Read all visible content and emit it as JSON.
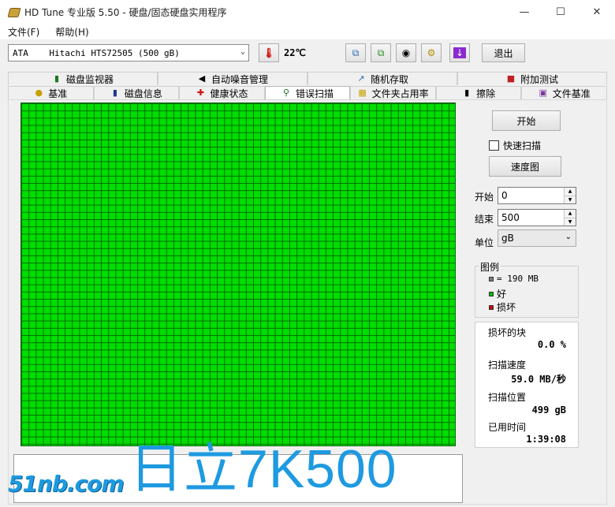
{
  "window": {
    "title": "HD Tune 专业版 5.50 - 硬盘/固态硬盘实用程序",
    "controls": {
      "minimize": "—",
      "maximize": "☐",
      "close": "✕"
    }
  },
  "menu": [
    {
      "label": "文件(F)"
    },
    {
      "label": "帮助(H)"
    }
  ],
  "toolbar": {
    "drive": "ATA    Hitachi HTS72505 (500 gB)",
    "temperature": "22℃",
    "icons": [
      "thermometer-icon",
      "copy-info-icon",
      "copy-text-icon",
      "camera-icon",
      "options-icon",
      "download-icon"
    ],
    "exit_label": "退出"
  },
  "tabs": {
    "row1": [
      {
        "label": "磁盘监视器",
        "icon": "disk-monitor-icon"
      },
      {
        "label": "自动噪音管理",
        "icon": "speaker-icon"
      },
      {
        "label": "随机存取",
        "icon": "random-access-icon"
      },
      {
        "label": "附加测试",
        "icon": "extra-tests-icon"
      }
    ],
    "row2": [
      {
        "label": "基准",
        "icon": "benchmark-icon"
      },
      {
        "label": "磁盘信息",
        "icon": "disk-info-icon"
      },
      {
        "label": "健康状态",
        "icon": "health-icon"
      },
      {
        "label": "错误扫描",
        "icon": "error-scan-icon",
        "active": true
      },
      {
        "label": "文件夹占用率",
        "icon": "folder-usage-icon"
      },
      {
        "label": "擦除",
        "icon": "erase-icon"
      },
      {
        "label": "文件基准",
        "icon": "file-benchmark-icon"
      }
    ]
  },
  "scan": {
    "start_button": "开始",
    "quick_scan_label": "快速扫描",
    "quick_scan_checked": false,
    "speed_map_button": "速度图",
    "start_label": "开始",
    "start_value": "0",
    "end_label": "结束",
    "end_value": "500",
    "unit_label": "单位",
    "unit_value": "gB",
    "grid_color_good": "#00dd00",
    "grid_line_color": "#006c00"
  },
  "legend": {
    "title": "图例",
    "block_size": "= 190 MB",
    "good": "好",
    "damaged": "损坏",
    "colors": {
      "block": "#808080",
      "good": "#00c000",
      "damaged": "#d00000"
    }
  },
  "stats": {
    "damaged_blocks_label": "损坏的块",
    "damaged_blocks_value": "0.0 %",
    "scan_speed_label": "扫描速度",
    "scan_speed_value": "59.0 MB/秒",
    "scan_position_label": "扫描位置",
    "scan_position_value": "499 gB",
    "elapsed_label": "已用时间",
    "elapsed_value": "1:39:08"
  },
  "watermark": {
    "model": "日立7K500",
    "site": "51nb.com"
  }
}
